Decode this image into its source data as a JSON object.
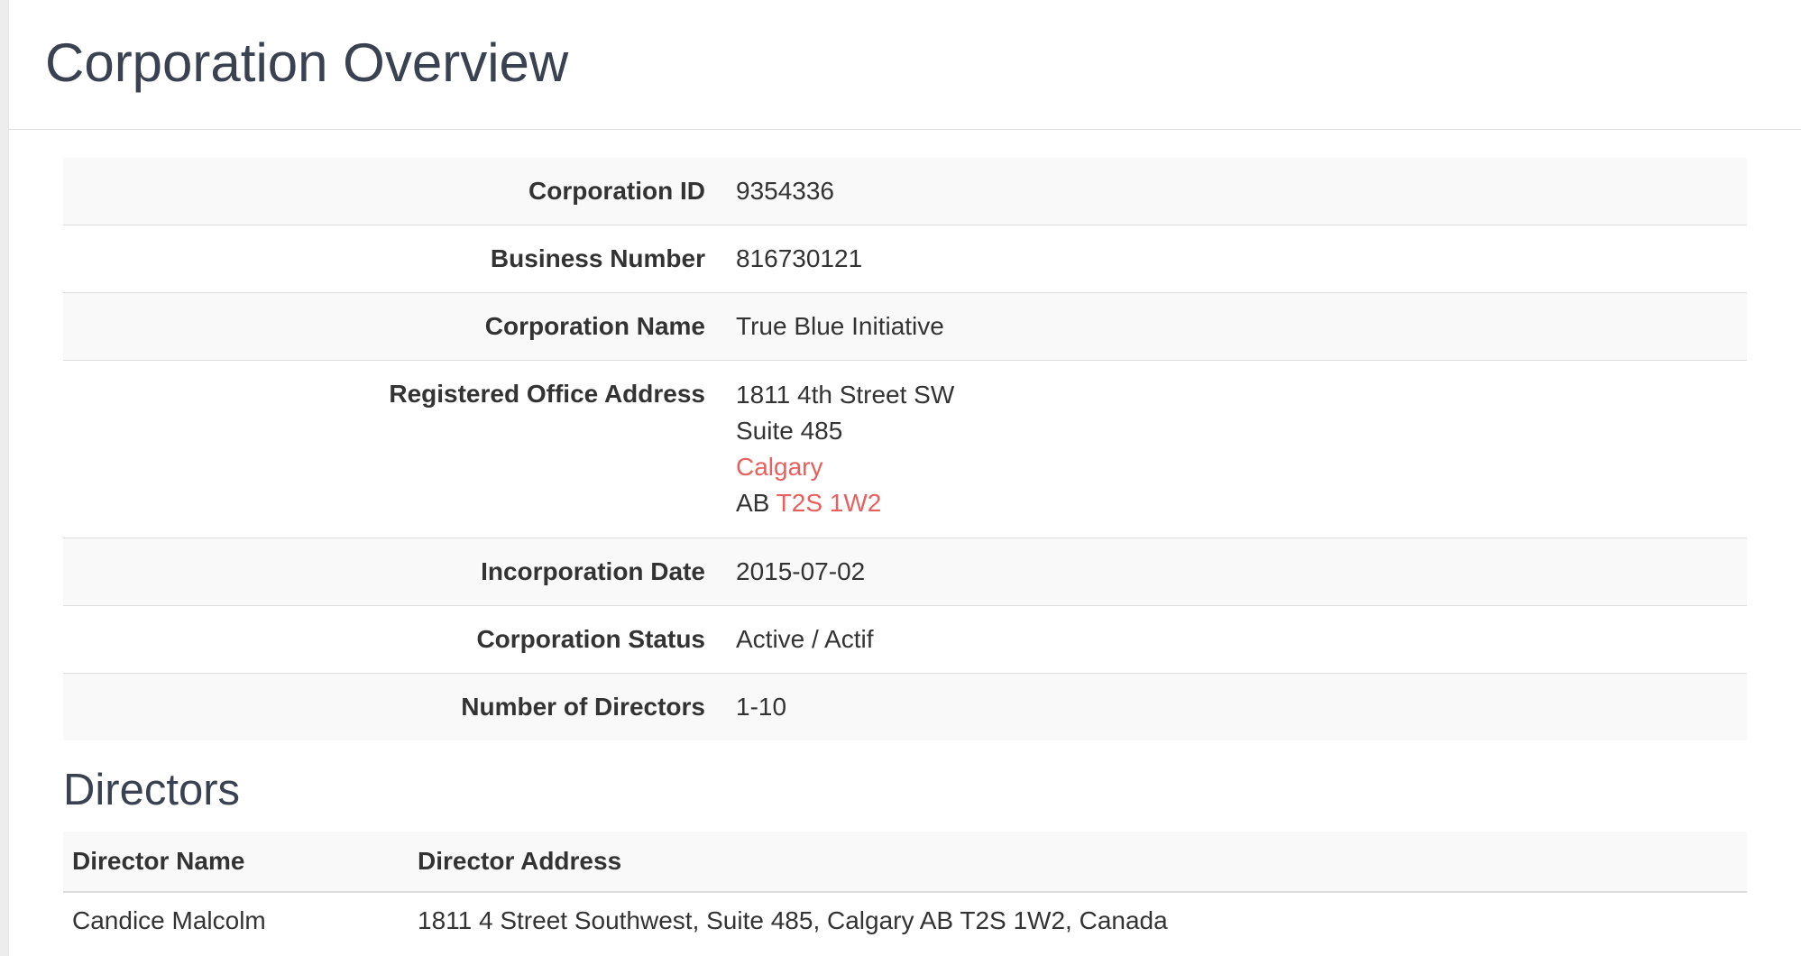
{
  "header": {
    "title": "Corporation Overview"
  },
  "overview": {
    "rows": [
      {
        "label": "Corporation ID",
        "value": "9354336"
      },
      {
        "label": "Business Number",
        "value": "816730121"
      },
      {
        "label": "Corporation Name",
        "value": "True Blue Initiative"
      },
      {
        "label": "Registered Office Address",
        "address": {
          "line1": "1811 4th Street SW",
          "line2": "Suite 485",
          "city": "Calgary",
          "province": "AB",
          "postal_code": "T2S 1W2"
        }
      },
      {
        "label": "Incorporation Date",
        "value": "2015-07-02"
      },
      {
        "label": "Corporation Status",
        "value": "Active / Actif"
      },
      {
        "label": "Number of Directors",
        "value": "1-10"
      }
    ]
  },
  "directors": {
    "title": "Directors",
    "columns": [
      "Director Name",
      "Director Address"
    ],
    "rows": [
      {
        "name": "Candice Malcolm",
        "address": "1811 4 Street Southwest, Suite 485, Calgary AB T2S 1W2, Canada"
      }
    ]
  },
  "colors": {
    "link": "#e8605e",
    "heading": "#3a4150",
    "stripe": "#f9f9f9",
    "border": "#dddddd"
  }
}
